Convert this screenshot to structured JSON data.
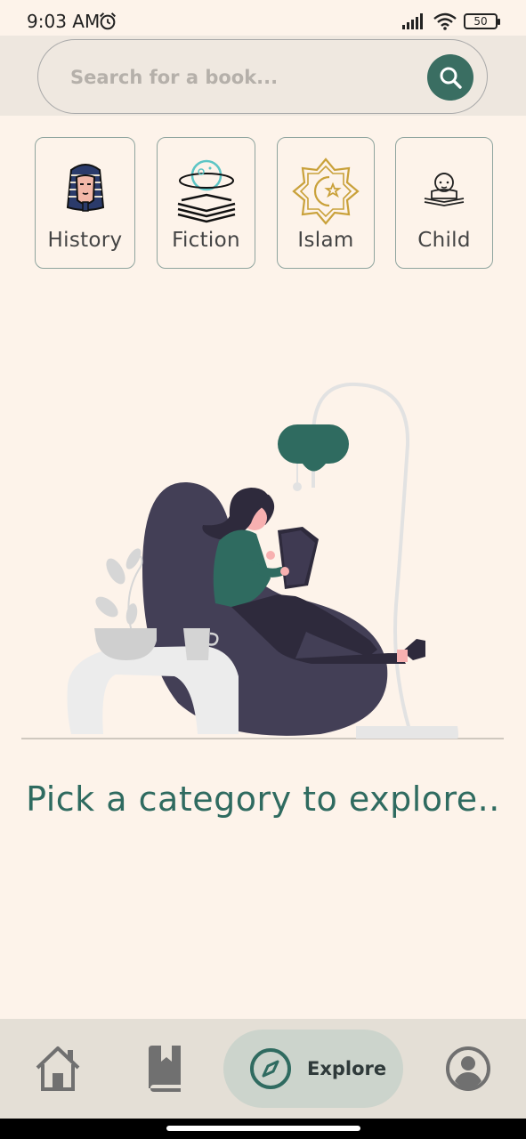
{
  "status_bar": {
    "time": "9:03 AM",
    "battery": "50"
  },
  "search": {
    "placeholder": "Search for a book..."
  },
  "categories": [
    {
      "label": "History",
      "icon": "pharaoh-icon"
    },
    {
      "label": "Fiction",
      "icon": "fiction-book-planet-icon"
    },
    {
      "label": "Islam",
      "icon": "islamic-star-crescent-icon"
    },
    {
      "label": "Child",
      "icon": "child-reading-icon"
    }
  ],
  "main": {
    "tagline": "Pick a category to explore.."
  },
  "bottom_nav": {
    "explore_label": "Explore"
  },
  "colors": {
    "background": "#fdf3ea",
    "accent": "#2f6b60",
    "search_button": "#3a6e62",
    "nav_background": "#e4dfd6",
    "active_pill": "#ccd4cc"
  }
}
